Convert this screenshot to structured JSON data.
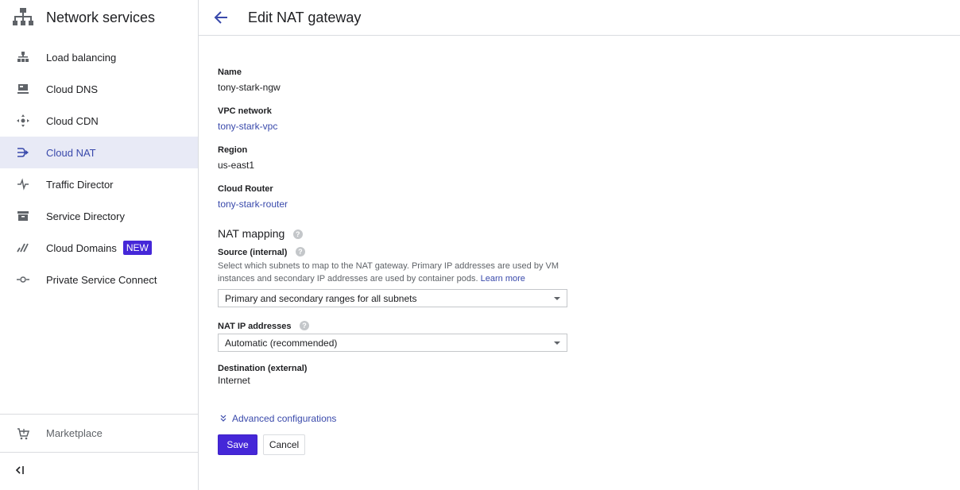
{
  "sidebar": {
    "title": "Network services",
    "items": [
      {
        "label": "Load balancing",
        "icon": "load-balancing-icon"
      },
      {
        "label": "Cloud DNS",
        "icon": "dns-icon"
      },
      {
        "label": "Cloud CDN",
        "icon": "cdn-icon"
      },
      {
        "label": "Cloud NAT",
        "icon": "nat-icon",
        "active": true
      },
      {
        "label": "Traffic Director",
        "icon": "traffic-director-icon"
      },
      {
        "label": "Service Directory",
        "icon": "service-directory-icon"
      },
      {
        "label": "Cloud Domains",
        "icon": "domains-icon",
        "badge": "NEW"
      },
      {
        "label": "Private Service Connect",
        "icon": "private-service-connect-icon"
      }
    ],
    "marketplace": "Marketplace"
  },
  "header": {
    "title": "Edit NAT gateway"
  },
  "form": {
    "name_label": "Name",
    "name_value": "tony-stark-ngw",
    "vpc_label": "VPC network",
    "vpc_value": "tony-stark-vpc",
    "region_label": "Region",
    "region_value": "us-east1",
    "router_label": "Cloud Router",
    "router_value": "tony-stark-router",
    "nat_mapping_title": "NAT mapping",
    "source_label": "Source (internal)",
    "source_desc": "Select which subnets to map to the NAT gateway. Primary IP addresses are used by VM instances and secondary IP addresses are used by container pods.",
    "learn_more": "Learn more",
    "source_selected": "Primary and secondary ranges for all subnets",
    "nat_ip_label": "NAT IP addresses",
    "nat_ip_selected": "Automatic (recommended)",
    "dest_label": "Destination (external)",
    "dest_value": "Internet",
    "advanced": "Advanced configurations",
    "save": "Save",
    "cancel": "Cancel"
  },
  "colors": {
    "accent": "#4527d8",
    "link": "#3949ab",
    "active_bg": "#e8eaf6"
  }
}
